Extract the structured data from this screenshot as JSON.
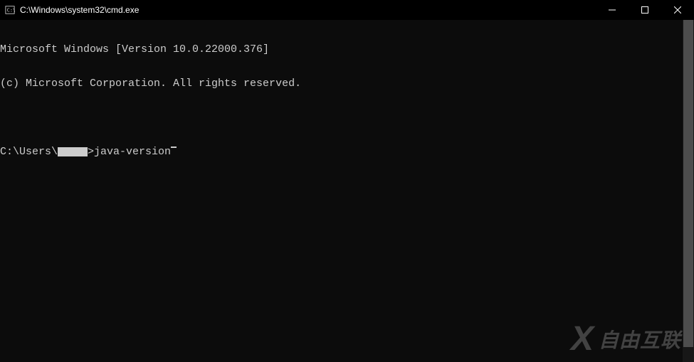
{
  "titlebar": {
    "title": "C:\\Windows\\system32\\cmd.exe"
  },
  "terminal": {
    "line1": "Microsoft Windows [Version 10.0.22000.376]",
    "line2": "(c) Microsoft Corporation. All rights reserved.",
    "prompt_prefix": "C:\\Users\\",
    "prompt_suffix": ">",
    "command": "java-version"
  },
  "watermark": {
    "x": "X",
    "text": "自由互联"
  }
}
